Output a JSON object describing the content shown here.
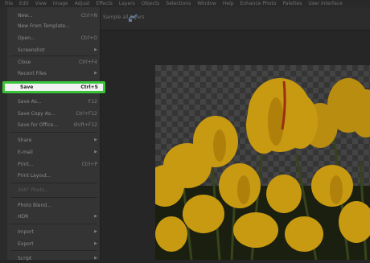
{
  "menubar": {
    "items": [
      "File",
      "Edit",
      "View",
      "Image",
      "Adjust",
      "Effects",
      "Layers",
      "Objects",
      "Selections",
      "Window",
      "Help",
      "Enhance Photo",
      "Palettes",
      "User Interface"
    ]
  },
  "toolbar": {
    "sample_label": "Sample all layers"
  },
  "file_menu": {
    "items": [
      {
        "label": "New...",
        "shortcut": "Ctrl+N"
      },
      {
        "label": "New From Template...",
        "shortcut": ""
      },
      {
        "label": "Open...",
        "shortcut": "Ctrl+O"
      },
      {
        "label": "Screenshot",
        "shortcut": ""
      },
      {
        "label": "Close",
        "shortcut": "Ctrl+F4"
      },
      {
        "label": "Recent Files",
        "shortcut": ""
      },
      {
        "label": "Save",
        "shortcut": "Ctrl+S"
      },
      {
        "label": "Save As...",
        "shortcut": "F12"
      },
      {
        "label": "Save Copy As...",
        "shortcut": "Ctrl+F12"
      },
      {
        "label": "Save for Office...",
        "shortcut": "Shift+F12"
      },
      {
        "label": "Share",
        "shortcut": ""
      },
      {
        "label": "E-mail",
        "shortcut": ""
      },
      {
        "label": "Print...",
        "shortcut": "Ctrl+P"
      },
      {
        "label": "Print Layout...",
        "shortcut": ""
      },
      {
        "label": "360° Photo...",
        "shortcut": ""
      },
      {
        "label": "Photo Blend...",
        "shortcut": ""
      },
      {
        "label": "HDR",
        "shortcut": ""
      },
      {
        "label": "Import",
        "shortcut": ""
      },
      {
        "label": "Export",
        "shortcut": ""
      },
      {
        "label": "Script",
        "shortcut": ""
      }
    ]
  },
  "colors": {
    "highlight_border": "#3ac43a",
    "menu_bg": "#343434",
    "tulip_yellow": "#d9a814"
  }
}
